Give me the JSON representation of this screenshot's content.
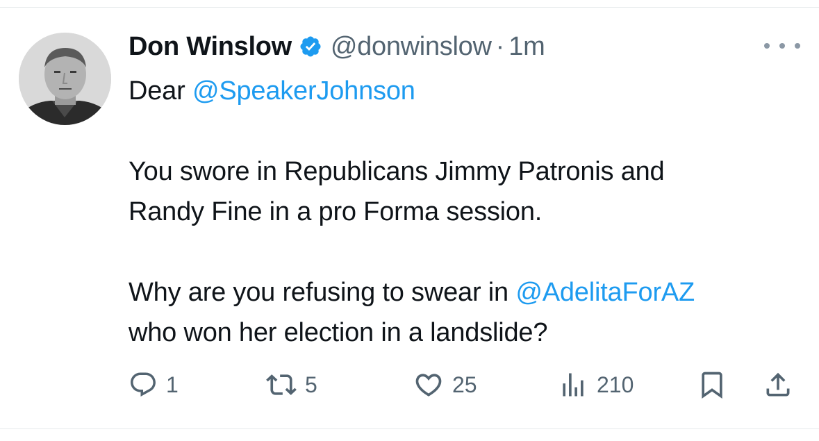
{
  "tweet": {
    "author_name": "Don Winslow",
    "handle": "@donwinslow",
    "separator": "·",
    "timestamp": "1m",
    "body": {
      "line1_prefix": "Dear ",
      "line1_mention": "@SpeakerJohnson",
      "line2": "You swore in Republicans Jimmy Patronis and",
      "line3": "Randy Fine in a pro Forma session.",
      "line4_prefix": "Why are you refusing to swear in ",
      "line4_mention": "@AdelitaForAZ",
      "line5": "who won her election in a landslide?"
    },
    "metrics": {
      "replies": "1",
      "reposts": "5",
      "likes": "25",
      "views": "210"
    }
  },
  "icons": {
    "verified": "verified-badge-icon",
    "more": "more-options-icon",
    "reply": "reply-icon",
    "repost": "repost-icon",
    "like": "heart-icon",
    "views": "views-chart-icon",
    "bookmark": "bookmark-icon",
    "share": "share-icon"
  },
  "colors": {
    "link": "#1d9bf0",
    "secondary_text": "#536471",
    "primary_text": "#0f1419",
    "verified": "#1d9bf0"
  }
}
